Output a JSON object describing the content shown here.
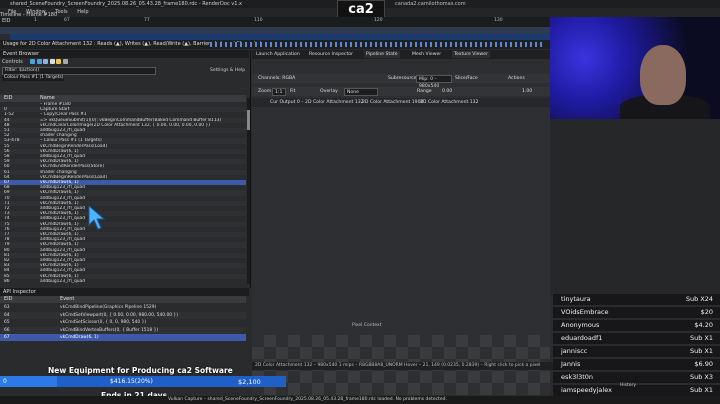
{
  "window": {
    "title": "shared_SceneFoundry_ScreenFoundry_2025.08.26_05.43.28_frame180.rdc - RenderDoc v1.x",
    "timeline_title": "Timeline - Frame #180",
    "menu": [
      "File",
      "Window",
      "Tools",
      "Help"
    ]
  },
  "logo": {
    "text": "ca2"
  },
  "header_url": "canada2.camilothomas.com",
  "timeline": {
    "eid_label": "EID",
    "ticks": [
      "1",
      "67",
      "77",
      "110",
      "120",
      "130"
    ],
    "usage_label": "Usage for 2D Color Attachment 132 : Reads (▲), Writes (▲), Read/Write (▲), Barriers (▲), and Clears (▲)"
  },
  "event_browser": {
    "tab": "Event Browser",
    "controls_label": "Controls",
    "filter_label": "Filter: $action()",
    "settings_label": "Settings & Help",
    "pass_label": "Colour Pass #1 (1 Targets)",
    "col_eid": "EID",
    "col_name": "Name",
    "rows": [
      {
        "eid": "",
        "name": "– Frame #180"
      },
      {
        "eid": "0",
        "name": "Capture Start"
      },
      {
        "eid": "1-52",
        "name": "– Copy/Clear Pass #1"
      },
      {
        "eid": "44",
        "name": "=> vkQueueSubmit(1)[0]: vkBeginCommandBuffer(Baked Command Buffer 8113)"
      },
      {
        "eid": "48",
        "name": "vkCmdClearColorImage(2D Color Attachment 132, { 0.00, 0.00, 0.00, 0.00 })"
      },
      {
        "eid": "51",
        "name": "addbug123_rfl_quad"
      },
      {
        "eid": "52",
        "name": "shader changing"
      },
      {
        "eid": "53-478",
        "name": "– Colour Pass #1 (1 Targets)"
      },
      {
        "eid": "55",
        "name": "vkCmdBeginRenderPass(Load)"
      },
      {
        "eid": "56",
        "name": "vkCmdDraw(6, 1)"
      },
      {
        "eid": "58",
        "name": "addbug123_rfl_quad"
      },
      {
        "eid": "59",
        "name": "vkCmdDraw(6, 1)"
      },
      {
        "eid": "60",
        "name": "vkCmdEndRenderPass(Store)"
      },
      {
        "eid": "61",
        "name": "shader changing"
      },
      {
        "eid": "64",
        "name": "vkCmdBeginRenderPass(Load)"
      },
      {
        "eid": "67",
        "name": "vkCmdDraw(6, 1)"
      },
      {
        "eid": "68",
        "name": "addbug123_rfl_quad"
      },
      {
        "eid": "69",
        "name": "vkCmdDraw(6, 1)"
      },
      {
        "eid": "70",
        "name": "addbug123_rfl_quad"
      },
      {
        "eid": "71",
        "name": "vkCmdDraw(6, 1)"
      },
      {
        "eid": "72",
        "name": "addbug123_rfl_quad"
      },
      {
        "eid": "73",
        "name": "vkCmdDraw(6, 1)"
      },
      {
        "eid": "74",
        "name": "addbug123_rfl_quad"
      },
      {
        "eid": "75",
        "name": "vkCmdDraw(6, 1)"
      },
      {
        "eid": "76",
        "name": "addbug123_rfl_quad"
      },
      {
        "eid": "77",
        "name": "vkCmdDraw(6, 1)"
      },
      {
        "eid": "78",
        "name": "addbug123_rfl_quad"
      },
      {
        "eid": "79",
        "name": "vkCmdDraw(6, 1)"
      },
      {
        "eid": "80",
        "name": "addbug123_rfl_quad"
      },
      {
        "eid": "81",
        "name": "vkCmdDraw(6, 1)"
      },
      {
        "eid": "82",
        "name": "addbug123_rfl_quad"
      },
      {
        "eid": "83",
        "name": "vkCmdDraw(6, 1)"
      },
      {
        "eid": "84",
        "name": "addbug123_rfl_quad"
      },
      {
        "eid": "85",
        "name": "vkCmdDraw(6, 1)"
      },
      {
        "eid": "86",
        "name": "addbug123_rfl_quad"
      }
    ]
  },
  "api_inspector": {
    "tab": "API Inspector",
    "col_eid": "EID",
    "col_event": "Event",
    "rows": [
      {
        "eid": "63",
        "event": "vkCmdBindPipeline(Graphics Pipeline 1529)"
      },
      {
        "eid": "64",
        "event": "vkCmdSetViewport(0, { 0.00, 0.00, 980.00, 540.00 })"
      },
      {
        "eid": "65",
        "event": "vkCmdSetScissor(0, { 0, 0, 980, 540 })"
      },
      {
        "eid": "66",
        "event": "vkCmdBindVertexBuffers(0, { Buffer 1518 })"
      },
      {
        "eid": "67",
        "event": "vkCmdDraw(6, 1)"
      }
    ]
  },
  "texture_viewer": {
    "tabs": [
      "Launch Application",
      "Resource Inspector",
      "Pipeline State",
      "Mesh Viewer",
      "Texture Viewer"
    ],
    "channels_label": "Channels: RGBA",
    "subresource_label": "Subresource",
    "mip_label": "Mip: 0 – 980x540",
    "slice_label": "Slice/Face",
    "actions_label": "Actions",
    "zoom_label": "Zoom",
    "zoom_value": "1:1",
    "fit_label": "Fit",
    "overlay_label": "Overlay",
    "overlay_value": "None",
    "range_label": "Range",
    "range_min": "0.00",
    "range_max": "1.00",
    "thumb_tabs": [
      "Cur Output 0 – 2D Color Attachment 132",
      "2D Color Attachment 1900",
      "2D Color Attachment 132"
    ],
    "status": "2D Color Attachment 132 – 980x540 1 mips – R8G8B8A8_UNORM    Hover – 21, 149 (0.0235, 0.2839) – Right click to pick a pixel",
    "pixel_context": "Pixel Context",
    "history_label": "History"
  },
  "stream": {
    "donations": [
      {
        "name": "tinytaura",
        "amount": "Sub X24"
      },
      {
        "name": "VOidsEmbrace",
        "amount": "$20"
      },
      {
        "name": "Anonymous",
        "amount": "$4.20"
      },
      {
        "name": "eduardoadf1",
        "amount": "Sub X1"
      },
      {
        "name": "janniscc",
        "amount": "Sub X1"
      },
      {
        "name": "Jannis",
        "amount": "$6.90"
      },
      {
        "name": "esk3l3t0n",
        "amount": "Sub X3"
      },
      {
        "name": "iamspeedyjalex",
        "amount": "Sub X1"
      }
    ],
    "goal": {
      "start": "0",
      "progress_text": "$416.15(20%)",
      "target": "$2,100",
      "title": "New Equipment for Producing ca2 Software",
      "ends": "Ends in 21 days",
      "fraction": 0.2
    }
  },
  "status_bar": "Vulkan Capture – shared_SceneFoundry_ScreenFoundry_2025.08.26_05.43.28_frame180.rdc loaded. No problems detected.",
  "colors": {
    "accent": "#3d5aa8",
    "banner": "#1f5fc8"
  }
}
